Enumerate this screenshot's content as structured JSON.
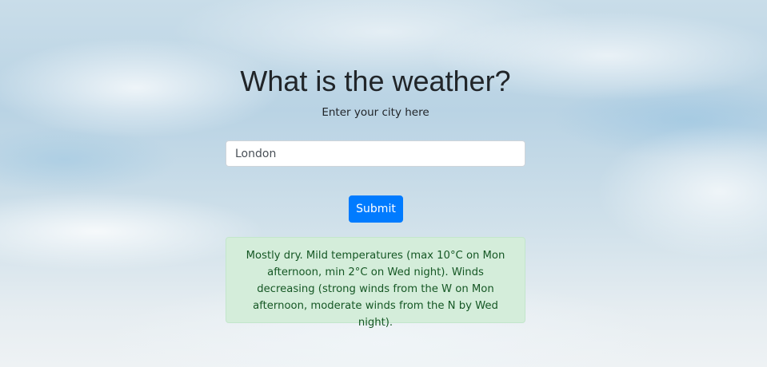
{
  "header": {
    "title": "What is the weather?",
    "subtitle": "Enter your city here"
  },
  "form": {
    "city_value": "London",
    "submit_label": "Submit"
  },
  "result": {
    "forecast_text": "Mostly dry. Mild temperatures (max 10°C on Mon afternoon, min 2°C on Wed night). Winds decreasing (strong winds from the W on Mon afternoon, moderate winds from the N by Wed night)."
  },
  "colors": {
    "button_bg": "#007bff",
    "alert_bg": "#d4edda",
    "alert_text": "#155724",
    "alert_border": "#c3e6cb"
  }
}
